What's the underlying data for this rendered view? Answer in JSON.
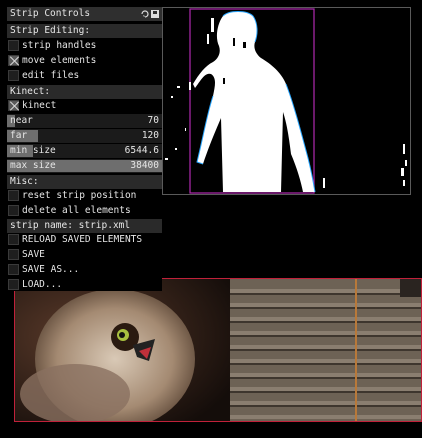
{
  "panel": {
    "title": "Strip Controls",
    "icons": [
      "refresh-icon",
      "save-icon"
    ],
    "strip_editing": {
      "header": "Strip Editing:",
      "items": [
        {
          "label": "strip handles",
          "checked": false
        },
        {
          "label": "move elements",
          "checked": true
        },
        {
          "label": "edit files",
          "checked": false
        }
      ]
    },
    "kinect": {
      "header": "Kinect:",
      "toggle": {
        "label": "kinect",
        "checked": true
      },
      "sliders": [
        {
          "label": "near",
          "value": "70",
          "fill": 0.05
        },
        {
          "label": "far",
          "value": "120",
          "fill": 0.2
        },
        {
          "label": "min size",
          "value": "6544.6",
          "fill": 0.17
        },
        {
          "label": "max size",
          "value": "38400",
          "fill": 1.0
        }
      ]
    },
    "misc": {
      "header": "Misc:",
      "items": [
        {
          "label": "reset strip position",
          "checked": false
        },
        {
          "label": "delete all elements",
          "checked": false
        }
      ],
      "strip_name": "strip name: strip.xml",
      "actions": [
        {
          "label": "RELOAD SAVED ELEMENTS",
          "checked": false
        },
        {
          "label": "SAVE",
          "checked": false
        },
        {
          "label": "SAVE AS...",
          "checked": false
        },
        {
          "label": "LOAD...",
          "checked": false
        }
      ]
    }
  },
  "colors": {
    "panel_bg": "#000000",
    "header_bg": "#2a2a2a",
    "slider_fill": "#6e6e6e",
    "video_border": "#c0213a",
    "bbox": "#b02ab0"
  }
}
